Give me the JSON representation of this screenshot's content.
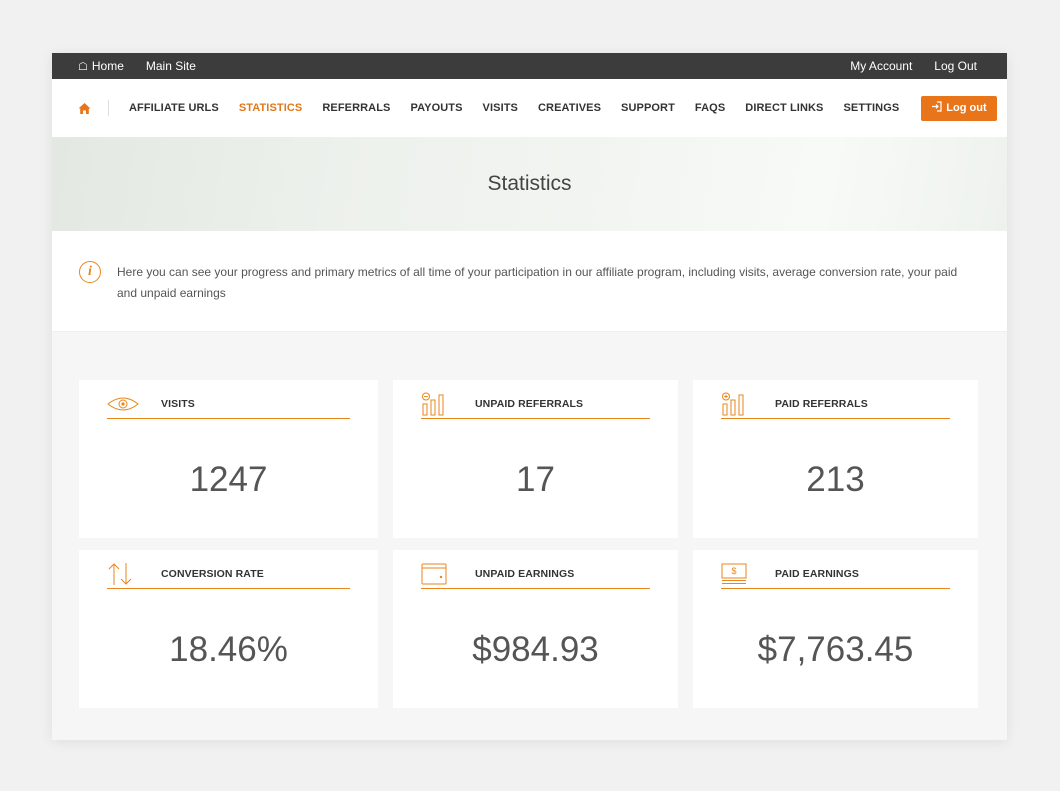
{
  "admin_bar": {
    "home_label": "Home",
    "main_site_label": "Main Site",
    "my_account_label": "My Account",
    "log_out_label": "Log Out"
  },
  "nav": {
    "items": [
      {
        "label": "AFFILIATE URLS",
        "active": false
      },
      {
        "label": "STATISTICS",
        "active": true
      },
      {
        "label": "REFERRALS",
        "active": false
      },
      {
        "label": "PAYOUTS",
        "active": false
      },
      {
        "label": "VISITS",
        "active": false
      },
      {
        "label": "CREATIVES",
        "active": false
      },
      {
        "label": "SUPPORT",
        "active": false
      },
      {
        "label": "FAQS",
        "active": false
      },
      {
        "label": "DIRECT LINKS",
        "active": false
      },
      {
        "label": "SETTINGS",
        "active": false
      }
    ],
    "logout_label": "Log out",
    "accent_color": "#e8751a"
  },
  "page": {
    "title": "Statistics",
    "info_text": "Here you can see your progress and primary metrics of all time of your participation in our affiliate program, including visits, average conversion rate, your paid and unpaid earnings"
  },
  "stats": [
    {
      "icon": "eye-icon",
      "title": "VISITS",
      "value": "1247"
    },
    {
      "icon": "unpaid-referrals-icon",
      "title": "UNPAID REFERRALS",
      "value": "17"
    },
    {
      "icon": "paid-referrals-icon",
      "title": "PAID REFERRALS",
      "value": "213"
    },
    {
      "icon": "conversion-arrows-icon",
      "title": "CONVERSION RATE",
      "value": "18.46%"
    },
    {
      "icon": "wallet-icon",
      "title": "UNPAID EARNINGS",
      "value": "$984.93"
    },
    {
      "icon": "cash-icon",
      "title": "PAID EARNINGS",
      "value": "$7,763.45"
    }
  ]
}
